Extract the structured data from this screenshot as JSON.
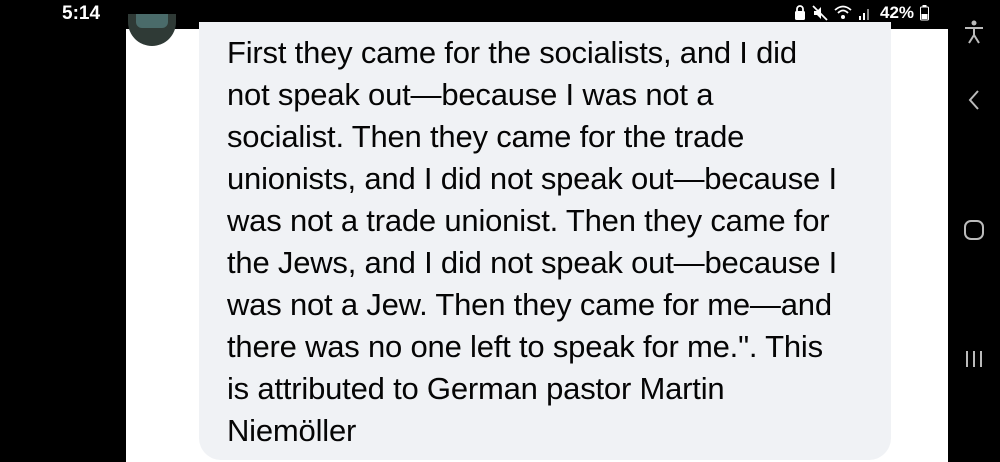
{
  "status_bar": {
    "time": "5:14",
    "battery": "42%",
    "icons": [
      "lock-icon",
      "mute-icon",
      "wifi-icon",
      "signal-icon",
      "battery-icon"
    ]
  },
  "message": {
    "lines": [
      "First they came for the socialists, and I did",
      "not speak out—because I was not a",
      "socialist. Then they came for the trade",
      "unionists, and I did not speak out—because I",
      "was not a trade unionist. Then they came for",
      "the Jews, and I did not speak out—because I",
      "was not a Jew. Then they came for me—and",
      "there was no one left to speak for me.\". This",
      "is attributed to German pastor Martin",
      "Niemöller"
    ]
  },
  "nav_bar": {
    "buttons": [
      "accessibility-icon",
      "back-icon",
      "home-icon",
      "recents-icon"
    ]
  },
  "colors": {
    "bubble": "#f0f2f5",
    "text": "#050505",
    "frame": "#000000"
  }
}
